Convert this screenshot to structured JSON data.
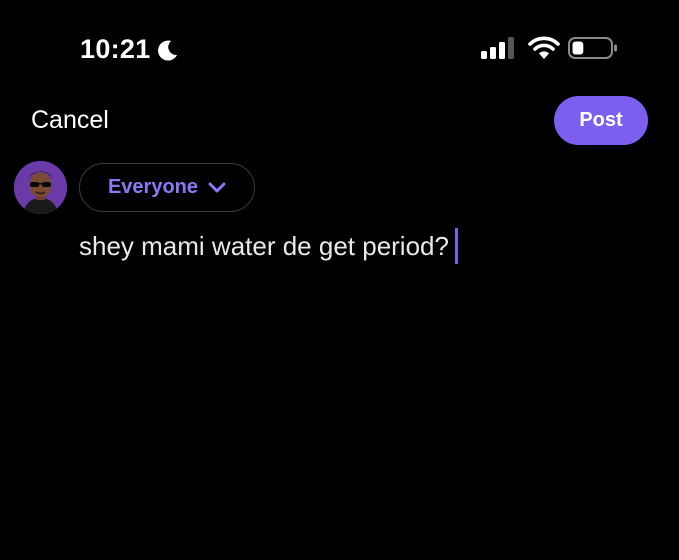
{
  "status_bar": {
    "time": "10:21",
    "icons": [
      "moon-icon",
      "cellular-signal-icon",
      "wifi-icon",
      "battery-icon"
    ],
    "battery_level": 0.3
  },
  "header": {
    "cancel_label": "Cancel",
    "post_label": "Post"
  },
  "audience": {
    "label": "Everyone",
    "icon": "chevron-down-icon"
  },
  "compose": {
    "text": "shey mami water de get period?"
  },
  "colors": {
    "background": "#000000",
    "accent": "#7d5ff0",
    "accent_text": "#8d78f3",
    "pill_border": "#3a3a3a",
    "text": "#ffffff"
  }
}
